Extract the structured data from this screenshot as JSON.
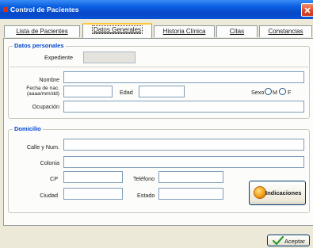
{
  "window": {
    "title": "Control de Pacientes"
  },
  "tabs": [
    {
      "label": "Lista de Pacientes"
    },
    {
      "label": "Datos Generales",
      "active": true
    },
    {
      "label": "Historia Clínica"
    },
    {
      "label": "Citas"
    },
    {
      "label": "Constancias"
    }
  ],
  "personal": {
    "legend": "Datos personales",
    "expediente_label": "Expediente",
    "expediente_value": "",
    "nombre_label": "Nombre",
    "nombre_value": "",
    "fecha_label_line1": "Fecha de nac.",
    "fecha_label_line2": "(aaaa/mm/dd)",
    "fecha_value": "",
    "edad_label": "Edad",
    "edad_value": "",
    "sexo_label": "Sexo",
    "sexo_options": [
      "M",
      "F"
    ],
    "ocupacion_label": "Ocupación",
    "ocupacion_value": ""
  },
  "domicilio": {
    "legend": "Domicilio",
    "calle_label": "Calle y Num.",
    "calle_value": "",
    "colonia_label": "Colonia",
    "colonia_value": "",
    "cp_label": "CP",
    "cp_value": "",
    "telefono_label": "Teléfono",
    "telefono_value": "",
    "ciudad_label": "Ciudad",
    "ciudad_value": "",
    "estado_label": "Estado",
    "estado_value": ""
  },
  "buttons": {
    "indicaciones": "Indicaciones",
    "aceptar": "Aceptar"
  }
}
